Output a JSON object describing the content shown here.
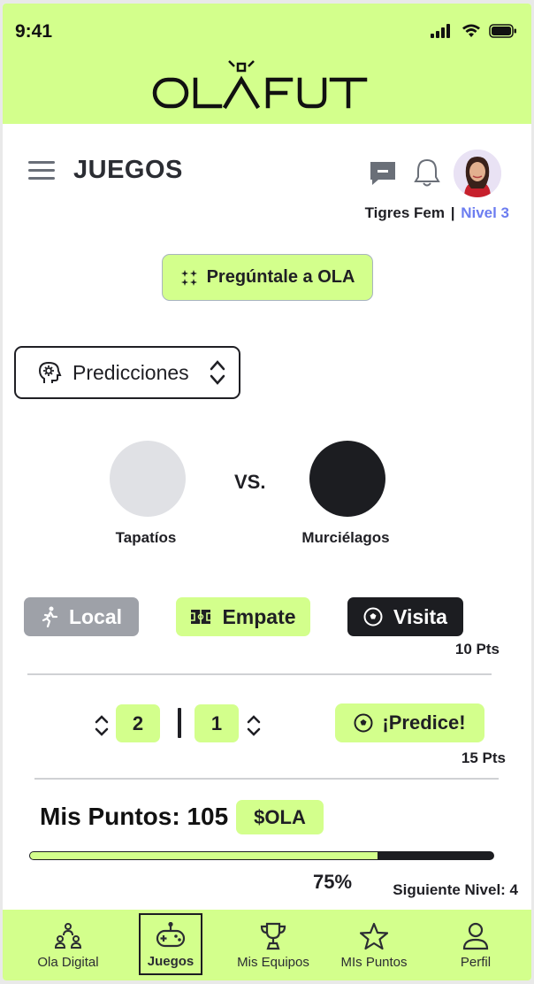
{
  "status_bar": {
    "time": "9:41"
  },
  "brand": {
    "logo_text": "OLAFUT"
  },
  "header": {
    "title": "JUEGOS",
    "user_team": "Tigres Fem",
    "separator": "|",
    "user_level": "Nivel 3"
  },
  "ask_button": {
    "label": "Pregúntale a OLA"
  },
  "mode_select": {
    "selected": "Predicciones"
  },
  "match": {
    "vs_label": "VS.",
    "home_team": "Tapatíos",
    "away_team": "Murciélagos"
  },
  "outcome_picks": {
    "local": "Local",
    "draw": "Empate",
    "away": "Visita",
    "points": "10 Pts"
  },
  "score_prediction": {
    "home_score": "2",
    "away_score": "1",
    "predict_label": "¡Predice!",
    "points": "15 Pts"
  },
  "my_points": {
    "label": "Mis Puntos: 105",
    "currency_badge": "$OLA",
    "progress_percent": 75,
    "progress_text": "75%",
    "next_level": "Siguiente Nivel: 4"
  },
  "bottom_nav": {
    "items": [
      {
        "label": "Ola Digital",
        "icon": "people-icon"
      },
      {
        "label": "Juegos",
        "icon": "gamepad-icon",
        "active": true
      },
      {
        "label": "Mis Equipos",
        "icon": "trophy-icon"
      },
      {
        "label": "MIs Puntos",
        "icon": "star-icon"
      },
      {
        "label": "Perfil",
        "icon": "user-icon"
      }
    ]
  },
  "colors": {
    "accent": "#d3ff8c",
    "dark": "#1c1d21",
    "level": "#6c7df0",
    "muted_button": "#9ea1a8"
  }
}
